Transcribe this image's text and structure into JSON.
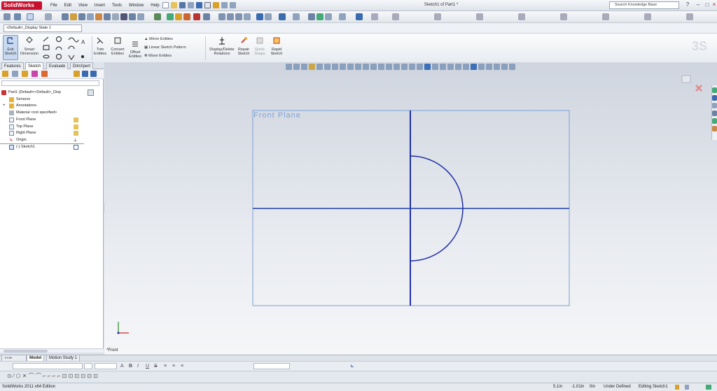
{
  "app": {
    "logo": "SolidWorks",
    "window_title": "Sketch1 of Part1 *",
    "search_placeholder": "Search Knowledge Base"
  },
  "menu": [
    "File",
    "Edit",
    "View",
    "Insert",
    "Tools",
    "Window",
    "Help"
  ],
  "configuration": {
    "selected": "<Default>_Display State 1"
  },
  "command_manager": {
    "exit_sketch": "Exit Sketch",
    "smart_dimension": "Smart Dimension",
    "trim_entities": "Trim Entities",
    "convert_entities": "Convert Entities",
    "offset_entities": "Offset Entities",
    "mirror_entities": "Mirror Entities",
    "linear_sketch_pattern": "Linear Sketch Pattern",
    "move_entities": "Move Entities",
    "display_delete_relations": "Display/Delete Relations",
    "repair_sketch": "Repair Sketch",
    "quick_snaps": "Quick Snaps",
    "rapid_sketch": "Rapid Sketch"
  },
  "panel_tabs": [
    "Features",
    "Sketch",
    "Evaluate",
    "DimXpert"
  ],
  "active_panel_tab": "Sketch",
  "tree": [
    {
      "label": "Part1  (Default<<Default>_Disp",
      "icon": "part-icon"
    },
    {
      "label": "Sensors",
      "icon": "sensors-icon"
    },
    {
      "label": "Annotations",
      "icon": "annotations-icon"
    },
    {
      "label": "Material <not specified>",
      "icon": "material-icon"
    },
    {
      "label": "Front Plane",
      "icon": "plane-icon"
    },
    {
      "label": "Top Plane",
      "icon": "plane-icon"
    },
    {
      "label": "Right Plane",
      "icon": "plane-icon"
    },
    {
      "label": "Origin",
      "icon": "origin-icon"
    },
    {
      "label": "(-) Sketch1",
      "icon": "sketch-icon"
    }
  ],
  "graphics": {
    "plane_label": "Front Plane",
    "view_label": "*Front",
    "sketch_color": "#1f2fa8",
    "plane_color": "#7fa0d6"
  },
  "bottom_tabs": [
    "Model",
    "Motion Study 1"
  ],
  "active_bottom_tab": "Model",
  "format_buttons": [
    "A",
    "B",
    "I",
    "U",
    "S"
  ],
  "status": {
    "edition": "SolidWorks 2011 x64 Edition",
    "x": "5.1in",
    "y": "-1.01in",
    "z": "0in",
    "definition": "Under Defined",
    "mode": "Editing Sketch1"
  }
}
